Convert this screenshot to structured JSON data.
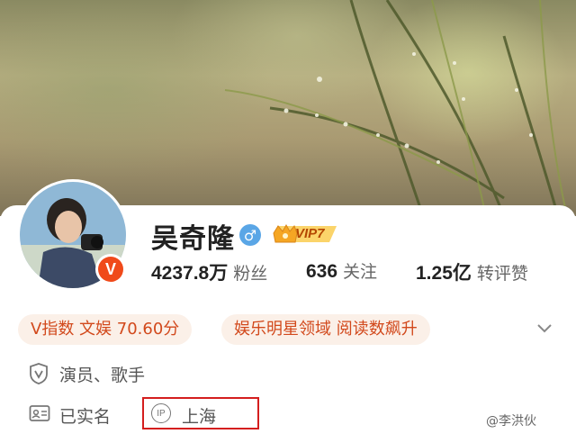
{
  "profile": {
    "name": "吴奇隆",
    "gender_icon": "male-icon",
    "gender_glyph": "♂",
    "vip_label": "VIP7",
    "verified_badge": "V"
  },
  "stats": {
    "followers_value": "4237.8万",
    "followers_label": "粉丝",
    "following_value": "636",
    "following_label": "关注",
    "reposts_value": "1.25亿",
    "reposts_label": "转评赞"
  },
  "tags": [
    {
      "label": "V指数 文娱 70.60分"
    },
    {
      "label": "娱乐明星领域 阅读数飙升"
    }
  ],
  "info": {
    "occupation": "演员、歌手",
    "identity": "已实名",
    "ip_icon_text": "IP",
    "ip_location": "上海"
  },
  "watermark": "@李洪伙",
  "colors": {
    "accent": "#d2491c",
    "tag_bg": "#fbf0e8",
    "highlight_box": "#d41e1e",
    "verified": "#f04a1a",
    "gender": "#5aa6e6"
  }
}
